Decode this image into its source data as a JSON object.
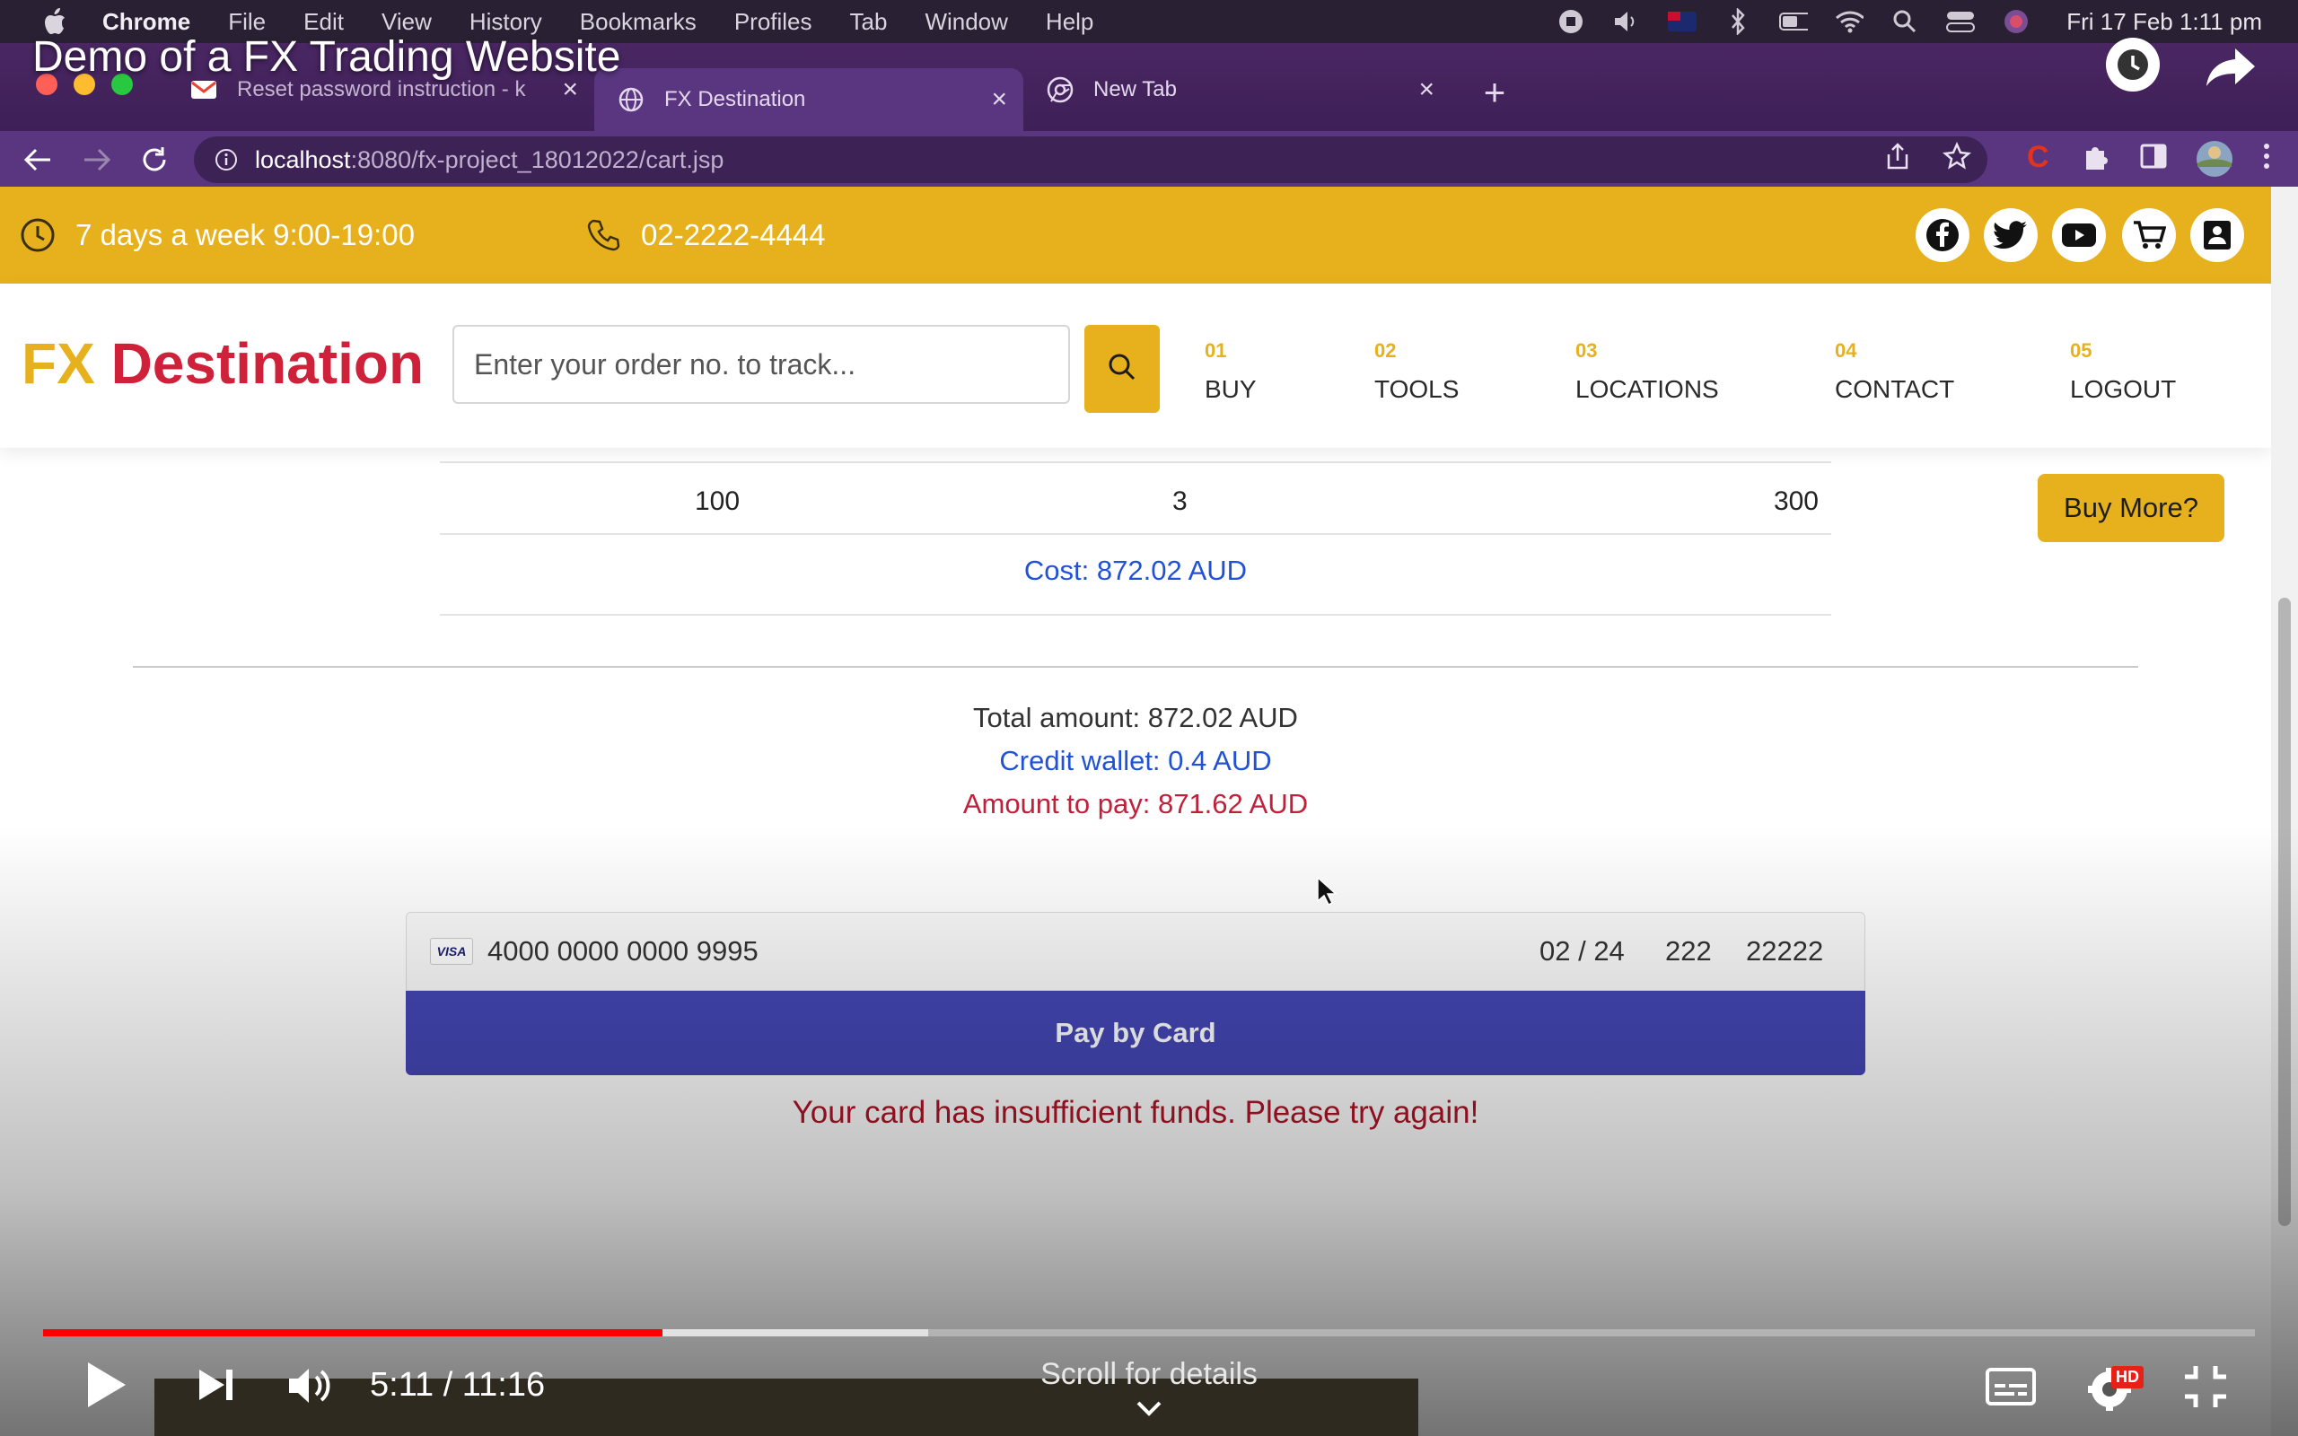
{
  "menubar": {
    "items": [
      "Chrome",
      "File",
      "Edit",
      "View",
      "History",
      "Bookmarks",
      "Profiles",
      "Tab",
      "Window",
      "Help"
    ],
    "clock": "Fri 17 Feb  1:11 pm"
  },
  "video": {
    "title": "Demo of a FX Trading Website",
    "timecode": "5:11 / 11:16",
    "scroll_hint": "Scroll for details",
    "progress_played": 0.28,
    "progress_buffered": 0.4,
    "hd_badge": "HD"
  },
  "tabs": [
    {
      "label": "Reset password instruction - k",
      "icon": "gmail-icon"
    },
    {
      "label": "FX Destination",
      "icon": "globe-icon"
    },
    {
      "label": "New Tab",
      "icon": "chrome-icon"
    }
  ],
  "address": {
    "host": "localhost",
    "path": ":8080/fx-project_18012022/cart.jsp"
  },
  "topbar": {
    "hours": "7 days a week 9:00-19:00",
    "phone": "02-2222-4444"
  },
  "header": {
    "logo_fx": "FX",
    "logo_dest": "Destination",
    "search_placeholder": "Enter your order no. to track...",
    "nav": [
      {
        "num": "01",
        "label": "BUY"
      },
      {
        "num": "02",
        "label": "TOOLS"
      },
      {
        "num": "03",
        "label": "LOCATIONS"
      },
      {
        "num": "04",
        "label": "CONTACT"
      },
      {
        "num": "05",
        "label": "LOGOUT"
      }
    ]
  },
  "cart": {
    "row": {
      "denomination": "100",
      "quantity": "3",
      "amount": "300"
    },
    "buy_more": "Buy More?",
    "cost": "Cost: 872.02 AUD"
  },
  "summary": {
    "total": "Total amount: 872.02 AUD",
    "credit": "Credit wallet: 0.4 AUD",
    "to_pay": "Amount to pay: 871.62 AUD"
  },
  "card": {
    "brand": "VISA",
    "number": "4000 0000 0000 9995",
    "expiry": "02 / 24",
    "cvc": "222",
    "postcode": "22222",
    "pay_label": "Pay by Card",
    "error": "Your card has insufficient funds. Please try again!"
  },
  "colors": {
    "brand_yellow": "#e6b11c",
    "brand_red": "#d0213b",
    "link_blue": "#2152d6",
    "pay_button": "#4447b5",
    "error_red": "#b01427",
    "progress_red": "#ff0000"
  }
}
